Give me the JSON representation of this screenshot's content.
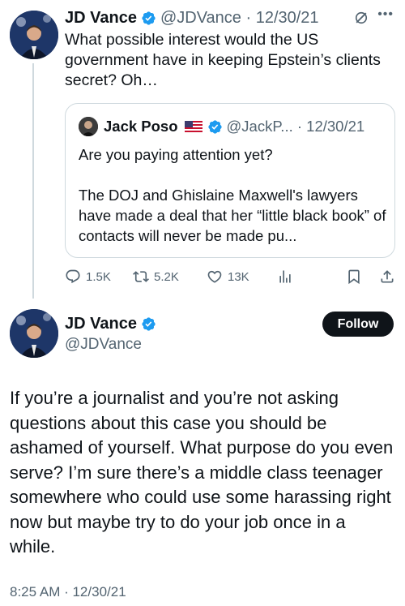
{
  "tweet1": {
    "author_name": "JD Vance",
    "handle_date": "@JDVance · 12/30/21",
    "text": "What possible interest would the US government have in keeping Epstein’s clients secret? Oh…",
    "quote": {
      "author_name": "Jack Poso",
      "handle_date": "@JackP... · 12/30/21",
      "line1": "Are you paying attention yet?",
      "line2": "The DOJ and Ghislaine Maxwell's lawyers have made a deal that her “little black book” of contacts will never be made pu..."
    },
    "actions": {
      "replies": "1.5K",
      "retweets": "5.2K",
      "likes": "13K"
    }
  },
  "tweet2": {
    "author_name": "JD Vance",
    "handle": "@JDVance",
    "follow_label": "Follow",
    "text": "If you’re a journalist and you’re not asking questions about this case you should be ashamed of yourself. What purpose do you even serve? I’m sure there’s a middle class teenager somewhere who could use some harassing right now but maybe try to do your job once in a while.",
    "timestamp": "8:25 AM · 12/30/21"
  },
  "colors": {
    "text": "#0f1419",
    "muted": "#536471",
    "verified": "#1d9bf0",
    "border": "#cfd9de",
    "follow_bg": "#0f1419"
  },
  "icons": [
    "verified-badge-icon",
    "grok-icon",
    "more-icon",
    "us-flag-icon",
    "reply-icon",
    "retweet-icon",
    "like-icon",
    "views-icon",
    "bookmark-icon",
    "share-icon"
  ]
}
